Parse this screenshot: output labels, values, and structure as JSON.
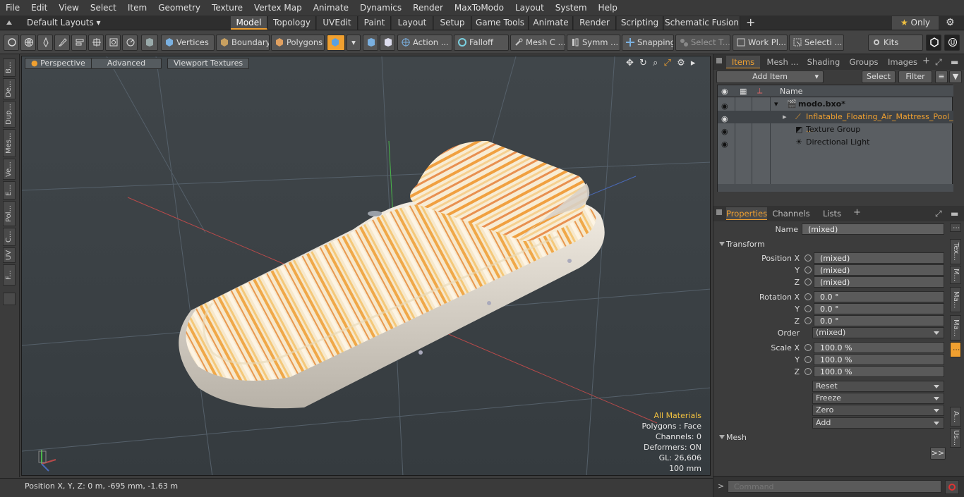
{
  "menu": [
    "File",
    "Edit",
    "View",
    "Select",
    "Item",
    "Geometry",
    "Texture",
    "Vertex Map",
    "Animate",
    "Dynamics",
    "Render",
    "MaxToModo",
    "Layout",
    "System",
    "Help"
  ],
  "layout_selector": "Default Layouts",
  "layout_tabs": [
    "Model",
    "Topology",
    "UVEdit",
    "Paint",
    "Layout",
    "Setup",
    "Game Tools",
    "Animate",
    "Render",
    "Scripting",
    "Schematic Fusion"
  ],
  "layout_tab_plus": "+",
  "only_label": "Only",
  "toolbar": {
    "vertices": "Vertices",
    "boundary": "Boundary",
    "polygons": "Polygons",
    "action": "Action",
    "action_more": "...",
    "falloff": "Falloff",
    "mesh_c": "Mesh C ...",
    "symm": "Symm ...",
    "snapping": "Snapping",
    "select_t": "Select T...",
    "work_pl": "Work Pl...",
    "selecti": "Selecti ...",
    "kits": "Kits"
  },
  "left_tabs": [
    "B...",
    "De...",
    "Dup...",
    "Mes...",
    "Ve...",
    "E...",
    "Pol...",
    "C...",
    "UV",
    "F..."
  ],
  "viewport": {
    "perspective": "Perspective",
    "advanced": "Advanced",
    "textures": "Viewport Textures",
    "hud": {
      "materials": "All Materials",
      "polygons": "Polygons : Face",
      "channels": "Channels: 0",
      "deformers": "Deformers: ON",
      "gl": "GL: 26,606",
      "scale": "100 mm"
    }
  },
  "status": {
    "position": "Position X, Y, Z:   0 m, -695 mm, -1.63 m"
  },
  "right_tabs": [
    "Items",
    "Mesh ...",
    "Shading",
    "Groups",
    "Images"
  ],
  "right_tab_plus": "+",
  "items_toolbar": {
    "add_item": "Add Item",
    "select": "Select",
    "filter": "Filter"
  },
  "items_header": "Name",
  "items": [
    {
      "name": "modo.bxo*",
      "bold": true,
      "indent": 0
    },
    {
      "name": "Inflatable_Floating_Air_Mattress_Pool_ ...",
      "indent": 1,
      "selected": true
    },
    {
      "name": "Texture Group",
      "indent": 1
    },
    {
      "name": "Directional Light",
      "indent": 1
    }
  ],
  "prop_tabs": [
    "Properties",
    "Channels",
    "Lists"
  ],
  "prop_tab_plus": "+",
  "properties": {
    "name_label": "Name",
    "name_value": "(mixed)",
    "transform": "Transform",
    "position_label": "Position X",
    "position": [
      "(mixed)",
      "(mixed)",
      "(mixed)"
    ],
    "rotation_label": "Rotation X",
    "rotation": [
      "0.0 °",
      "0.0 °",
      "0.0 °"
    ],
    "order_label": "Order",
    "order": "(mixed)",
    "scale_label": "Scale X",
    "scale": [
      "100.0 %",
      "100.0 %",
      "100.0 %"
    ],
    "y_label": "Y",
    "z_label": "Z",
    "actions": [
      "Reset",
      "Freeze",
      "Zero",
      "Add"
    ],
    "mesh": "Mesh",
    "expand": ">>"
  },
  "right_vtabs": [
    "Tex...",
    "M...",
    "Ma...",
    "Ma...",
    "A...",
    "Us..."
  ],
  "command_placeholder": "Command",
  "command_prompt": ">",
  "accent": "#f0a030"
}
